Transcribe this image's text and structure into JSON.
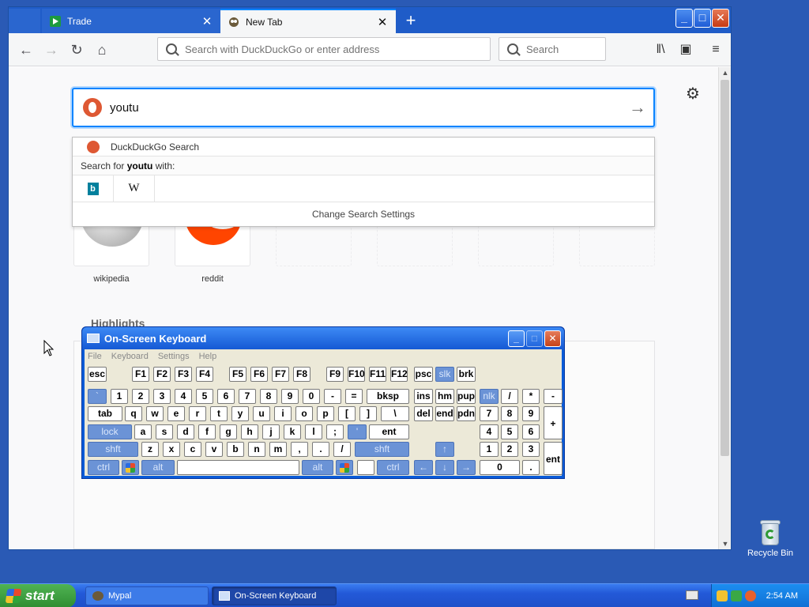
{
  "browser": {
    "tabs": [
      {
        "title": "Trade"
      },
      {
        "title": "New Tab"
      }
    ],
    "urlbar_placeholder": "Search with DuckDuckGo or enter address",
    "searchbar_placeholder": "Search"
  },
  "newtab": {
    "search_value": "youtu",
    "suggestions": {
      "engine_row": "DuckDuckGo Search",
      "search_for_prefix": "Search for ",
      "search_for_term": "youtu",
      "search_for_suffix": " with:",
      "engines": [
        "bing",
        "W"
      ],
      "change_settings": "Change Search Settings"
    },
    "top_sites": [
      {
        "label": "wikipedia"
      },
      {
        "label": "reddit"
      }
    ],
    "highlights_title": "Highlights"
  },
  "osk": {
    "title": "On-Screen Keyboard",
    "menu": [
      "File",
      "Keyboard",
      "Settings",
      "Help"
    ]
  },
  "desktop": {
    "recycle_bin": "Recycle Bin"
  },
  "taskbar": {
    "start": "start",
    "tasks": [
      {
        "label": "Mypal"
      },
      {
        "label": "On-Screen Keyboard"
      }
    ],
    "clock": "2:54 AM"
  }
}
